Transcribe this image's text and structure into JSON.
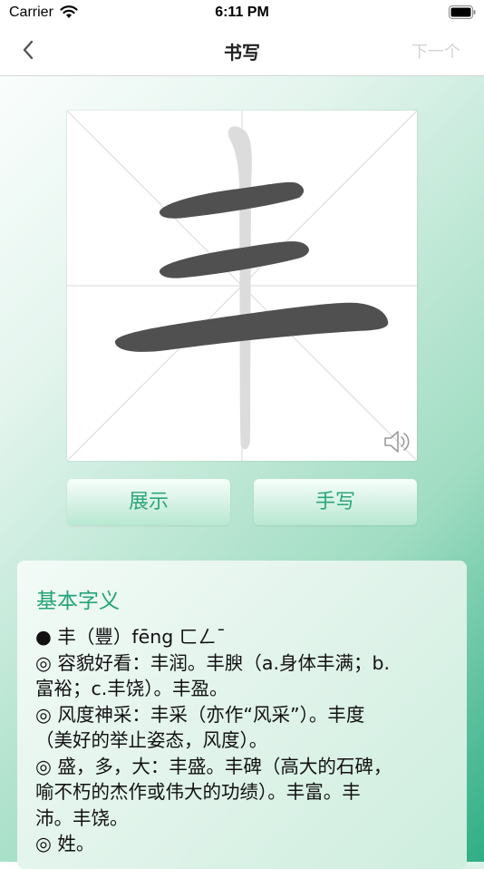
{
  "status_bar": {
    "carrier": "Carrier",
    "time": "6:11 PM"
  },
  "nav": {
    "title": "书写",
    "next_label": "下一个"
  },
  "character": {
    "glyph": "丰",
    "stroke_color": "#505050",
    "ghost_color": "#dcdcdc"
  },
  "buttons": {
    "show_label": "展示",
    "handwrite_label": "手写"
  },
  "definition": {
    "heading": "基本字义",
    "lines": [
      "● 丰（豐）fēng ㄈㄥˉ",
      "◎ 容貌好看：丰润。丰腴（a.身体丰满；b.",
      "富裕；c.丰饶）。丰盈。",
      "◎ 风度神采：丰采（亦作“风采”）。丰度",
      "（美好的举止姿态，风度）。",
      "◎ 盛，多，大：丰盛。丰碑（高大的石碑，",
      "喻不朽的杰作或伟大的功绩）。丰富。丰",
      "沛。丰饶。",
      "◎ 姓。"
    ]
  },
  "colors": {
    "accent": "#2aa67a",
    "heading": "#23a378"
  }
}
